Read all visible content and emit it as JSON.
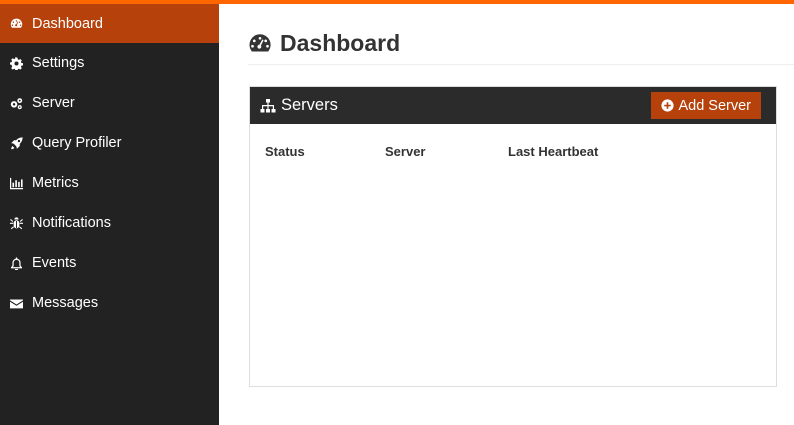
{
  "sidebar": {
    "items": [
      {
        "label": "Dashboard",
        "icon": "dashboard-icon",
        "active": true
      },
      {
        "label": "Settings",
        "icon": "gear-icon"
      },
      {
        "label": "Server",
        "icon": "gears-icon"
      },
      {
        "label": "Query Profiler",
        "icon": "rocket-icon"
      },
      {
        "label": "Metrics",
        "icon": "bar-chart-icon"
      },
      {
        "label": "Notifications",
        "icon": "bug-icon"
      },
      {
        "label": "Events",
        "icon": "bell-icon"
      },
      {
        "label": "Messages",
        "icon": "envelope-icon"
      }
    ]
  },
  "page": {
    "title": "Dashboard",
    "icon": "dashboard-icon"
  },
  "servers_panel": {
    "title": "Servers",
    "icon": "sitemap-icon",
    "add_button_label": "Add Server",
    "columns": [
      "Status",
      "Server",
      "Last Heartbeat"
    ],
    "rows": []
  },
  "colors": {
    "accent": "#ff6600",
    "active": "#b6410b",
    "sidebar_bg": "#222222",
    "panel_header_bg": "#2b2b2b"
  }
}
